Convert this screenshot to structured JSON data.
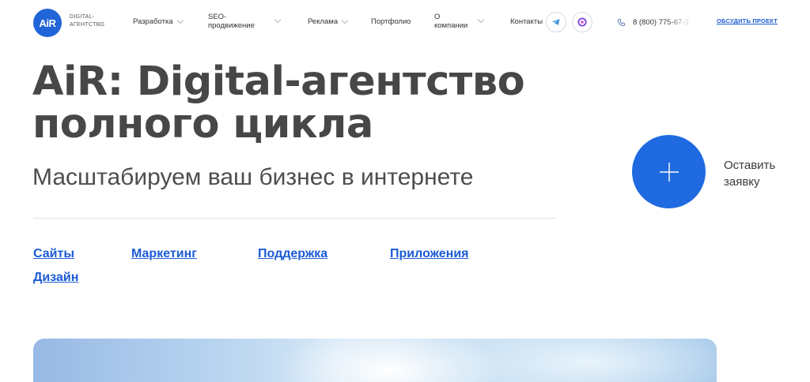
{
  "header": {
    "logo_text": "AiR",
    "logo_sub_line1": "DIGITAL-",
    "logo_sub_line2": "АГЕНТСТВО",
    "nav": {
      "development": "Разработка",
      "seo_line1": "SEO-",
      "seo_line2": "продвижение",
      "ads": "Реклама",
      "portfolio": "Портфолио",
      "about_line1": "О",
      "about_line2": "компании",
      "contacts": "Контакты"
    },
    "phone": "8 (800) 775-67-3",
    "cta": "ОБСУДИТЬ ПРОЕКТ",
    "colors": {
      "brand": "#2166d8",
      "link": "#1b5bd6"
    },
    "icons": [
      "phone-icon",
      "telegram-icon",
      "messenger-icon"
    ]
  },
  "hero": {
    "title_line1": "AiR: Digital-агентство",
    "title_line2": "полного цикла",
    "subtitle": "Масштабируем ваш бизнес в интернете",
    "request_line1": "Оставить",
    "request_line2": "заявку"
  },
  "services": {
    "sites": "Сайты",
    "marketing": "Маркетинг",
    "support": "Поддержка",
    "apps": "Приложения",
    "design": "Дизайн"
  }
}
